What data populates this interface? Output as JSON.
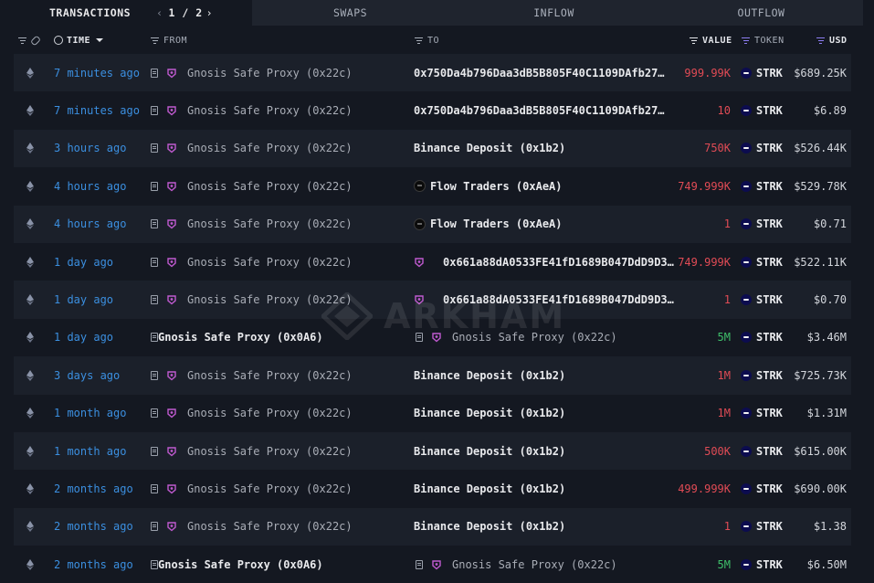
{
  "tabs": {
    "transactions": "TRANSACTIONS",
    "page_indicator": "1 / 2",
    "swaps": "SWAPS",
    "inflow": "INFLOW",
    "outflow": "OUTFLOW"
  },
  "columns": {
    "time": "TIME",
    "from": "FROM",
    "to": "TO",
    "value": "VALUE",
    "token": "TOKEN",
    "usd": "USD"
  },
  "watermark": "ARKHAM",
  "rows": [
    {
      "time": "7 minutes ago",
      "from": "Gnosis Safe Proxy (0x22c)",
      "to": "0x750Da4b796Daa3dB5B805F40C1109DAfb27…",
      "value": "999.99K",
      "token": "STRK",
      "usd": "$689.25K"
    },
    {
      "time": "7 minutes ago",
      "from": "Gnosis Safe Proxy (0x22c)",
      "to": "0x750Da4b796Daa3dB5B805F40C1109DAfb27…",
      "value": "10",
      "token": "STRK",
      "usd": "$6.89"
    },
    {
      "time": "3 hours ago",
      "from": "Gnosis Safe Proxy (0x22c)",
      "to": "Binance Deposit (0x1b2)",
      "value": "750K",
      "token": "STRK",
      "usd": "$526.44K"
    },
    {
      "time": "4 hours ago",
      "from": "Gnosis Safe Proxy (0x22c)",
      "to": "Flow Traders (0xAeA)",
      "value": "749.999K",
      "token": "STRK",
      "usd": "$529.78K"
    },
    {
      "time": "4 hours ago",
      "from": "Gnosis Safe Proxy (0x22c)",
      "to": "Flow Traders (0xAeA)",
      "value": "1",
      "token": "STRK",
      "usd": "$0.71"
    },
    {
      "time": "1 day ago",
      "from": "Gnosis Safe Proxy (0x22c)",
      "to": "0x661a88dA0533FE41fD1689B047DdD9D3…",
      "value": "749.999K",
      "token": "STRK",
      "usd": "$522.11K"
    },
    {
      "time": "1 day ago",
      "from": "Gnosis Safe Proxy (0x22c)",
      "to": "0x661a88dA0533FE41fD1689B047DdD9D3…",
      "value": "1",
      "token": "STRK",
      "usd": "$0.70"
    },
    {
      "time": "1 day ago",
      "from": "Gnosis Safe Proxy (0x0A6)",
      "to": "Gnosis Safe Proxy (0x22c)",
      "value": "5M",
      "token": "STRK",
      "usd": "$3.46M"
    },
    {
      "time": "3 days ago",
      "from": "Gnosis Safe Proxy (0x22c)",
      "to": "Binance Deposit (0x1b2)",
      "value": "1M",
      "token": "STRK",
      "usd": "$725.73K"
    },
    {
      "time": "1 month ago",
      "from": "Gnosis Safe Proxy (0x22c)",
      "to": "Binance Deposit (0x1b2)",
      "value": "1M",
      "token": "STRK",
      "usd": "$1.31M"
    },
    {
      "time": "1 month ago",
      "from": "Gnosis Safe Proxy (0x22c)",
      "to": "Binance Deposit (0x1b2)",
      "value": "500K",
      "token": "STRK",
      "usd": "$615.00K"
    },
    {
      "time": "2 months ago",
      "from": "Gnosis Safe Proxy (0x22c)",
      "to": "Binance Deposit (0x1b2)",
      "value": "499.999K",
      "token": "STRK",
      "usd": "$690.00K"
    },
    {
      "time": "2 months ago",
      "from": "Gnosis Safe Proxy (0x22c)",
      "to": "Binance Deposit (0x1b2)",
      "value": "1",
      "token": "STRK",
      "usd": "$1.38"
    },
    {
      "time": "2 months ago",
      "from": "Gnosis Safe Proxy (0x0A6)",
      "to": "Gnosis Safe Proxy (0x22c)",
      "value": "5M",
      "token": "STRK",
      "usd": "$6.50M"
    }
  ]
}
